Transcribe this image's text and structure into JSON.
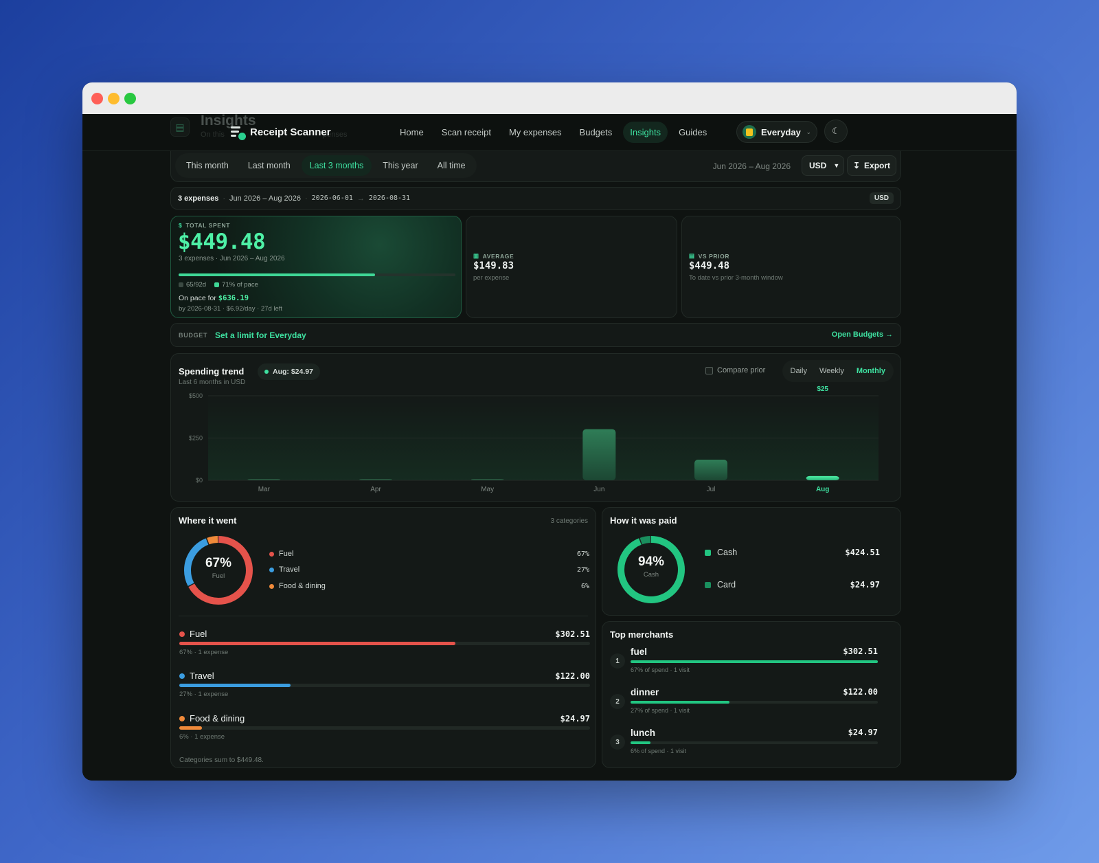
{
  "window": {
    "title": "Receipt Scanner"
  },
  "page_ghost": {
    "title": "Insights",
    "subtitle_start": "On this",
    "subtitle_end": "penses"
  },
  "nav": {
    "brand": "Receipt Scanner",
    "links": [
      {
        "label": "Home",
        "active": false
      },
      {
        "label": "Scan receipt",
        "active": false
      },
      {
        "label": "My expenses",
        "active": false
      },
      {
        "label": "Budgets",
        "active": false
      },
      {
        "label": "Insights",
        "active": true
      },
      {
        "label": "Guides",
        "active": false
      }
    ],
    "profile": "Everyday",
    "theme_icon": "moon-icon"
  },
  "filters": {
    "ranges": [
      {
        "label": "This month",
        "active": false
      },
      {
        "label": "Last month",
        "active": false
      },
      {
        "label": "Last 3 months",
        "active": true
      },
      {
        "label": "This year",
        "active": false
      },
      {
        "label": "All time",
        "active": false
      }
    ],
    "date_range": "Jun 2026 – Aug 2026",
    "currency": "USD",
    "export_label": "Export"
  },
  "summary": {
    "count": "3 expenses",
    "range": "Jun 2026 – Aug 2026",
    "start": "2026-06-01",
    "arrow": "→",
    "end": "2026-08-31",
    "currency_badge": "USD"
  },
  "kpi": {
    "total": {
      "label": "TOTAL SPENT",
      "value": "$449.48",
      "meta": "3 expenses · Jun 2026 – Aug 2026",
      "pace_fraction": 0.71,
      "days": "65/92d",
      "pace": "71% of pace",
      "on_pace_prefix": "On pace for",
      "on_pace_value": "$636.19",
      "footer": "by 2026-08-31 · $6.92/day · 27d left"
    },
    "average": {
      "label": "AVERAGE",
      "value": "$149.83",
      "sub": "per expense"
    },
    "vs_prior": {
      "label": "VS PRIOR",
      "value": "$449.48",
      "sub": "To date vs prior 3-month window"
    }
  },
  "budget": {
    "tag": "BUDGET",
    "link": "Set a limit for Everyday",
    "open": "Open Budgets →"
  },
  "trend": {
    "title": "Spending trend",
    "subtitle": "Last 6 months in USD",
    "highlight": "Aug: $24.97",
    "compare_label": "Compare prior",
    "granularity": [
      {
        "label": "Daily",
        "active": false
      },
      {
        "label": "Weekly",
        "active": false
      },
      {
        "label": "Monthly",
        "active": true
      }
    ]
  },
  "chart_data": {
    "type": "bar",
    "categories": [
      "Mar",
      "Apr",
      "May",
      "Jun",
      "Jul",
      "Aug"
    ],
    "values": [
      0,
      0,
      0,
      302.51,
      122.0,
      24.97
    ],
    "highlighted": "Aug",
    "highlight_label": "$25",
    "yticks": [
      "$500",
      "$250",
      "$0"
    ],
    "ylim": [
      0,
      500
    ],
    "grid": true
  },
  "where": {
    "title": "Where it went",
    "note": "3 categories",
    "center_pct": "67%",
    "center_label": "Fuel",
    "categories": [
      {
        "name": "Fuel",
        "pct": "67%",
        "fraction": 0.673,
        "amount": "$302.51",
        "meta": "67% · 1 expense",
        "color": "#e5534b"
      },
      {
        "name": "Travel",
        "pct": "27%",
        "fraction": 0.271,
        "amount": "$122.00",
        "meta": "27% · 1 expense",
        "color": "#3b9de0"
      },
      {
        "name": "Food & dining",
        "pct": "6%",
        "fraction": 0.056,
        "amount": "$24.97",
        "meta": "6% · 1 expense",
        "color": "#f08a3a"
      }
    ],
    "footer": "Categories sum to $449.48."
  },
  "paid": {
    "title": "How it was paid",
    "center_pct": "94%",
    "center_label": "Cash",
    "methods": [
      {
        "name": "Cash",
        "amount": "$424.51",
        "fraction": 0.944,
        "color": "#22c581"
      },
      {
        "name": "Card",
        "amount": "$24.97",
        "fraction": 0.056,
        "color": "#1a8f5e"
      }
    ]
  },
  "merchants": {
    "title": "Top merchants",
    "items": [
      {
        "rank": "1",
        "name": "fuel",
        "amount": "$302.51",
        "fraction": 1.0,
        "meta": "67% of spend · 1 visit"
      },
      {
        "rank": "2",
        "name": "dinner",
        "amount": "$122.00",
        "fraction": 0.4,
        "meta": "27% of spend · 1 visit"
      },
      {
        "rank": "3",
        "name": "lunch",
        "amount": "$24.97",
        "fraction": 0.08,
        "meta": "6% of spend · 1 visit"
      }
    ]
  }
}
